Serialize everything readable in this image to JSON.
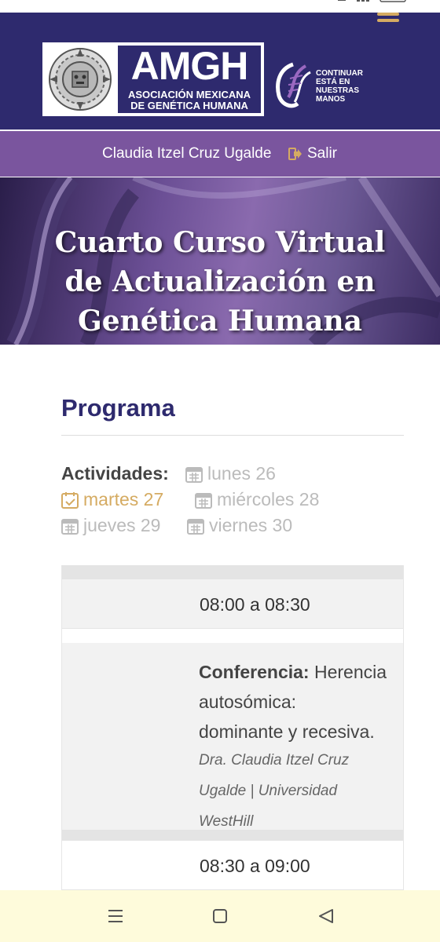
{
  "header": {
    "logo": {
      "title": "AMGH",
      "subtitle_line1": "ASOCIACIÓN MEXICANA",
      "subtitle_line2": "DE GENÉTICA HUMANA"
    },
    "slogan": [
      "CONTINUAR",
      "ESTÁ EN",
      "NUESTRAS",
      "MANOS"
    ],
    "accent_color": "#d5ab62",
    "background_color": "#2e2a6e"
  },
  "user_bar": {
    "user_name": "Claudia Itzel Cruz Ugalde",
    "logout_label": "Salir",
    "background_color": "#7a559e"
  },
  "banner": {
    "title_lines": [
      "Cuarto Curso Virtual",
      "de Actualización en",
      "Genética Humana"
    ]
  },
  "page": {
    "section_title": "Programa",
    "activities_label": "Actividades:",
    "days": [
      {
        "label": "lunes 26",
        "selected": false
      },
      {
        "label": "martes 27",
        "selected": true
      },
      {
        "label": "miércoles 28",
        "selected": false
      },
      {
        "label": "jueves 29",
        "selected": false
      },
      {
        "label": "viernes 30",
        "selected": false
      }
    ]
  },
  "schedule": [
    {
      "time": "08:00 a 08:30",
      "type_label": "Conferencia:",
      "title_lines": [
        "Herencia",
        "autosómica:",
        "dominante y recesiva."
      ],
      "speaker_lines": [
        "Dra. Claudia Itzel Cruz",
        "Ugalde | Universidad",
        "WestHill"
      ]
    },
    {
      "time": "08:30 a 09:00"
    }
  ],
  "nav_icons": [
    "menu-icon",
    "home-icon",
    "back-icon"
  ]
}
